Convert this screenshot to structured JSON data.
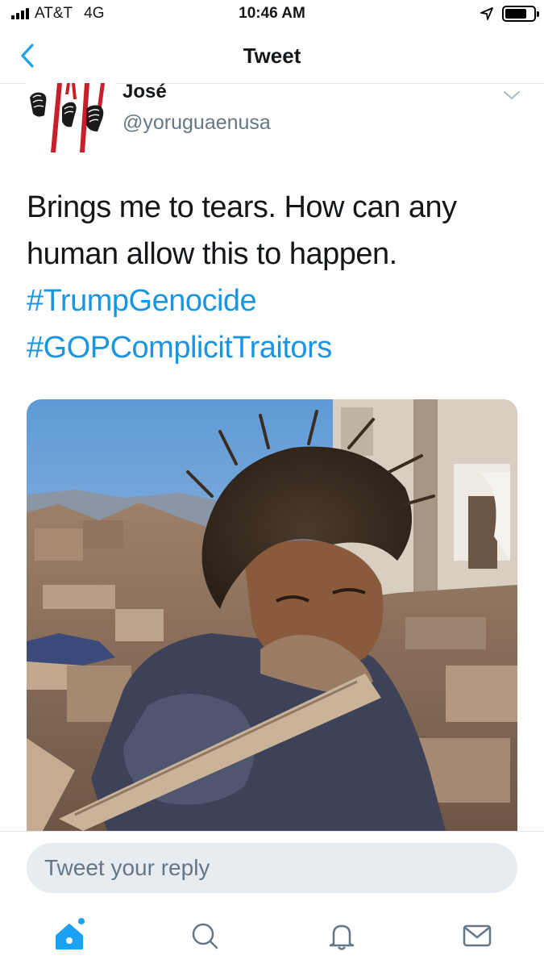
{
  "status_bar": {
    "carrier": "AT&T",
    "network": "4G",
    "time": "10:46 AM"
  },
  "nav": {
    "title": "Tweet",
    "back_icon": "chevron-left-icon"
  },
  "tweet": {
    "author_name": "José",
    "author_handle": "@yoruguaenusa",
    "text_lines": [
      "Brings me to tears. How can any",
      "human allow this to happen."
    ],
    "hashtags": [
      "#TrumpGenocide",
      "#GOPComplicitTraitors"
    ]
  },
  "reply": {
    "placeholder": "Tweet your reply"
  },
  "tab_bar": {
    "tabs": [
      "home-icon",
      "search-icon",
      "notifications-bell-icon",
      "messages-mail-icon"
    ]
  },
  "colors": {
    "accent": "#1da1f2",
    "hashtag": "#1b95e0",
    "secondary_text": "#657786",
    "reply_bg": "#e6ecf0",
    "divider": "#e1e8ed"
  }
}
